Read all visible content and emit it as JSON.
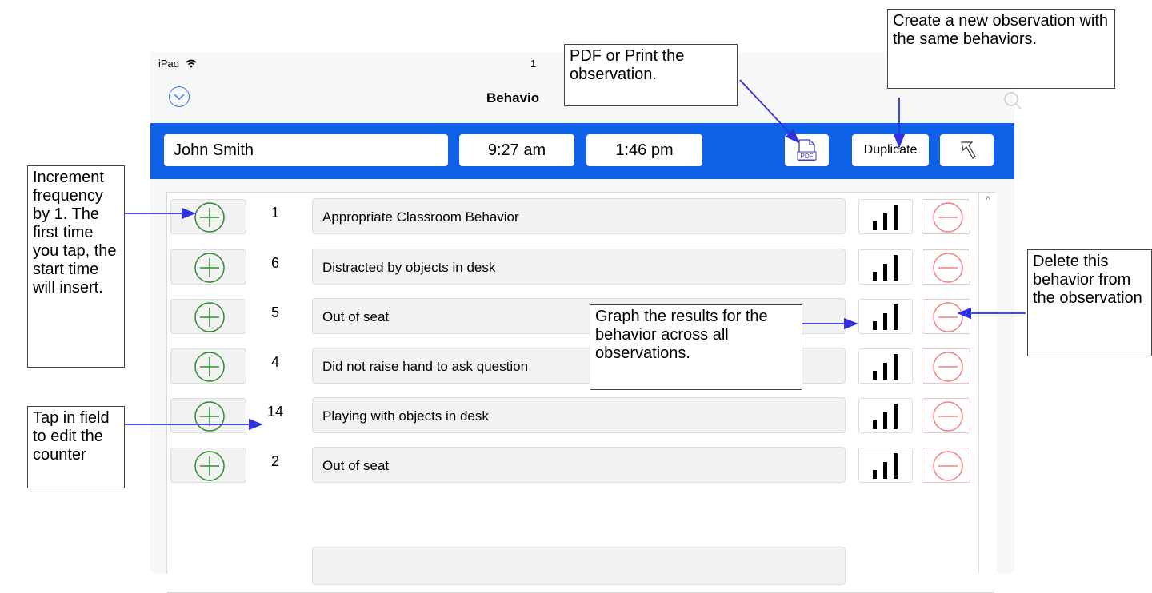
{
  "status": {
    "device": "iPad",
    "time": "1"
  },
  "nav": {
    "title": "Behavio"
  },
  "toolbar": {
    "student_name": "John Smith",
    "start_time": "9:27 am",
    "end_time": "1:46 pm",
    "pdf_label": "PDF",
    "duplicate_label": "Duplicate"
  },
  "behaviors": [
    {
      "count": "1",
      "name": "Appropriate Classroom Behavior"
    },
    {
      "count": "6",
      "name": "Distracted by objects in desk"
    },
    {
      "count": "5",
      "name": "Out  of seat"
    },
    {
      "count": "4",
      "name": "Did not raise hand to ask question"
    },
    {
      "count": "14",
      "name": "Playing with objects in desk"
    },
    {
      "count": "2",
      "name": "Out  of seat"
    }
  ],
  "callouts": {
    "pdf": "PDF or Print the observation.",
    "duplicate": "Create a new observation with the same behaviors.",
    "increment": "Increment frequency by 1. The first time you tap, the start time will insert.",
    "counter": "Tap in field to edit the counter",
    "graph": "Graph the results for the behavior across all observations.",
    "delete": "Delete this behavior from the observation"
  },
  "colors": {
    "toolbar": "#0f62e8",
    "plus": "#2e8b2e",
    "minus": "#f08080",
    "arrow": "#3030e0"
  }
}
